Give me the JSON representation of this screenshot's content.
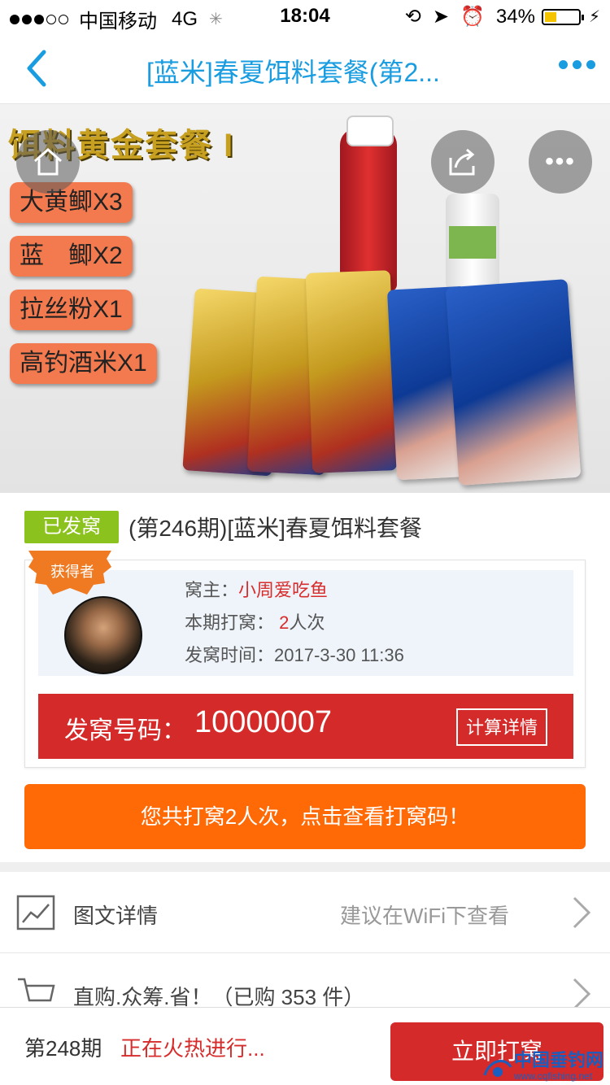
{
  "status_bar": {
    "carrier": "中国移动",
    "network": "4G",
    "time": "18:04",
    "battery": "34%"
  },
  "nav": {
    "title": "[蓝米]春夏饵料套餐(第2..."
  },
  "hero": {
    "banner_title": "饵料黄金套餐 I",
    "tags": [
      "大黄鲫X3",
      "蓝　鲫X2",
      "拉丝粉X1",
      "高钓酒米X1"
    ]
  },
  "product": {
    "status_badge": "已发窝",
    "title": "(第246期)[蓝米]春夏饵料套餐"
  },
  "winner": {
    "seal_label": "获得者",
    "owner_label": "窝主：",
    "owner_name": "小周爱吃鱼",
    "count_label": "本期打窝：",
    "count_value": "2",
    "count_unit": "人次",
    "time_label": "发窝时间：",
    "time_value": "2017-3-30 11:36",
    "code_label": "发窝号码：",
    "code_value": "10000007",
    "calc_button": "计算详情"
  },
  "cta": {
    "label": "您共打窝2人次，点击查看打窝码！"
  },
  "list": {
    "details_label": "图文详情",
    "details_hint": "建议在WiFi下查看",
    "buy_label": "直购.众筹.省！（已购 353 件）"
  },
  "bottom": {
    "period": "第248期",
    "state": "正在火热进行...",
    "join_button": "立即打窝",
    "watermark_text": "中国垂钓网",
    "watermark_url": "www.cqfishing.net"
  },
  "colors": {
    "accent_blue": "#1a9de0",
    "red": "#d42a2a",
    "orange": "#ff6a06",
    "green": "#8cc21d"
  }
}
